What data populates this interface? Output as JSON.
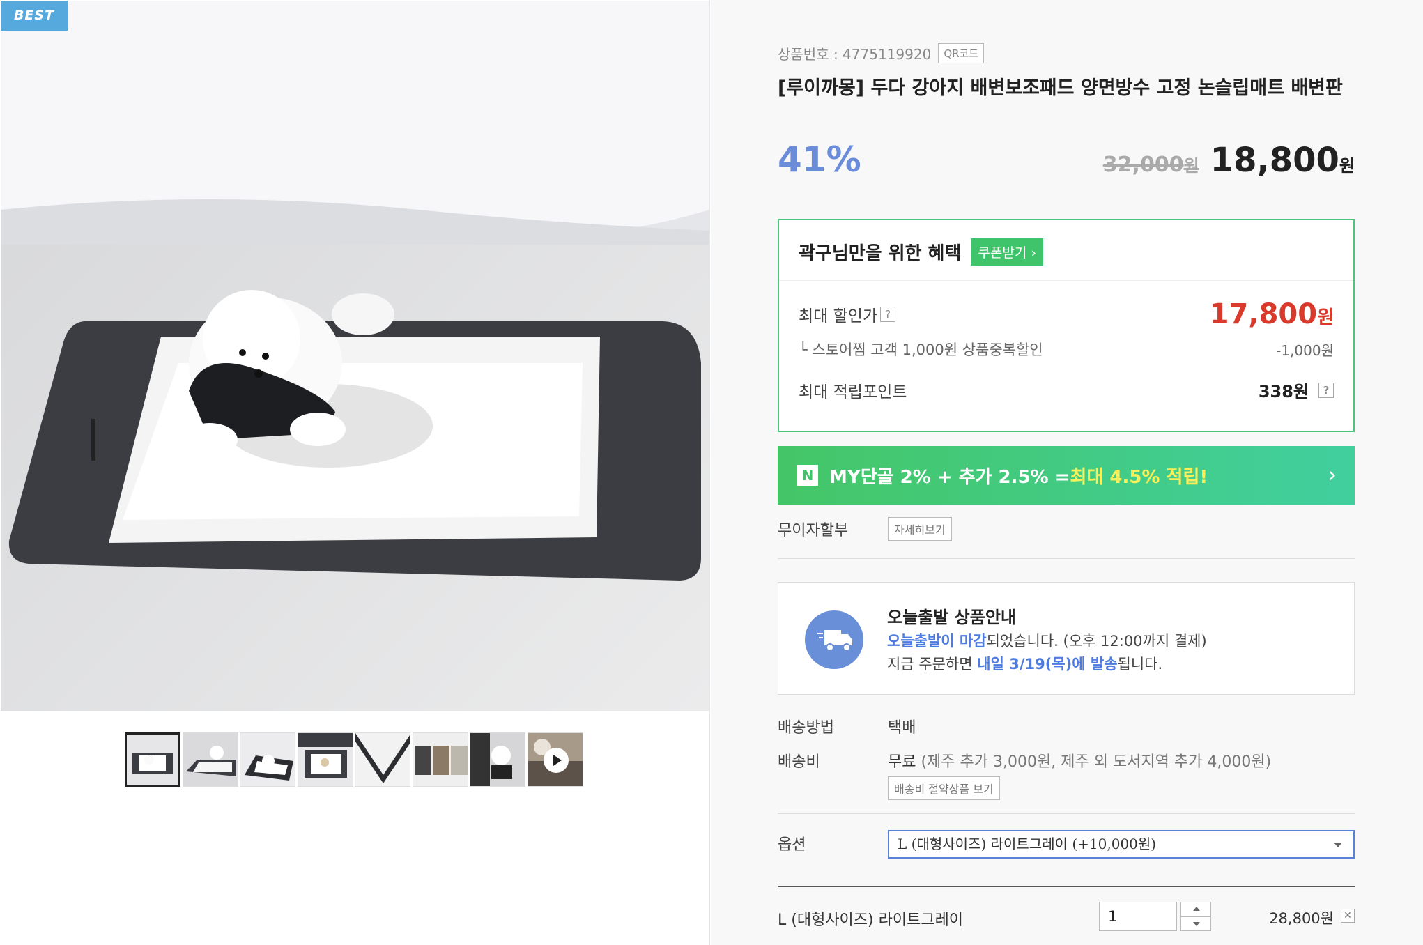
{
  "gallery": {
    "badge": "BEST"
  },
  "product": {
    "code_text": "상품번호 : 4775119920",
    "qr_label": "QR코드",
    "title": "[루이까몽] 두다 강아지 배변보조패드 양면방수 고정 논슬립매트 배변판",
    "discount": "41%",
    "original_price": "32,000",
    "final_price": "18,800",
    "won": "원"
  },
  "benefit": {
    "title": "곽구님만을 위한 혜택",
    "coupon_label": "쿠폰받기 ›",
    "max_discount_label": "최대 할인가",
    "max_discount_value": "17,800",
    "store_label": "└  스토어찜 고객 1,000원 상품중복할인",
    "store_value": "-1,000원",
    "point_label": "최대 적립포인트",
    "point_value": "338원",
    "help": "?"
  },
  "npay": {
    "icon": "N",
    "text_a": "MY단골 2% + 추가 2.5% = ",
    "text_b": "최대 4.5% 적립!",
    "arrow": "›"
  },
  "installment": {
    "label": "무이자할부",
    "button": "자세히보기"
  },
  "shipping_notice": {
    "title": "오늘출발 상품안내",
    "line1_highlight": "오늘출발이 마감",
    "line1_rest": "되었습니다. (오후 12:00까지 결제)",
    "line2_a": "지금 주문하면 ",
    "line2_highlight": "내일 3/19(목)에 발송",
    "line2_b": "됩니다."
  },
  "delivery": {
    "method_label": "배송방법",
    "method_value": "택배",
    "fee_label": "배송비",
    "fee_value": "무료",
    "fee_note": " (제주 추가 3,000원, 제주 외 도서지역 추가 4,000원)",
    "fee_button": "배송비 절약상품 보기"
  },
  "option": {
    "label": "옵션",
    "selected": "L (대형사이즈) 라이트그레이 (+10,000원)"
  },
  "selected_item": {
    "name": "L (대형사이즈) 라이트그레이",
    "quantity": "1",
    "price": "28,800원",
    "remove": "✕"
  },
  "colors": {
    "discount_blue": "#6b8cd8",
    "red_price": "#d93a2c",
    "green": "#3fc46b",
    "badge_blue": "#55a9dc"
  }
}
